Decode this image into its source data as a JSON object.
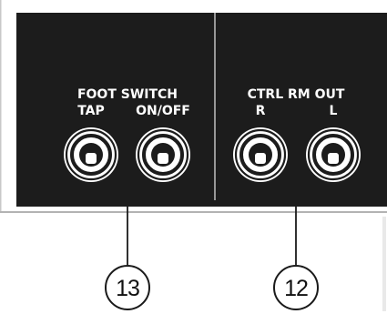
{
  "panel": {
    "foot_switch": {
      "heading": "FOOT SWITCH",
      "tap_label": "TAP",
      "onoff_label": "ON/OFF",
      "callout": "13"
    },
    "ctrl_rm_out": {
      "heading": "CTRL RM OUT",
      "r_label": "R",
      "l_label": "L",
      "callout": "12"
    }
  },
  "colors": {
    "panel": "#1c1c1c",
    "label": "#ffffff",
    "line": "#1a1a1a"
  },
  "icons": [
    "jack-socket-icon"
  ]
}
